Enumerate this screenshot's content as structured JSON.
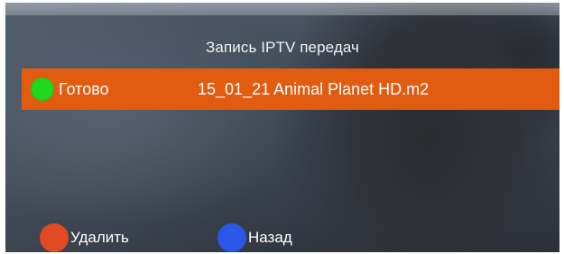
{
  "header": {
    "title": "Запись IPTV передач"
  },
  "recordings": [
    {
      "status": "Готово",
      "status_color": "#22d81c",
      "file_name": "15_01_21 Animal Planet HD.m2"
    }
  ],
  "footer": {
    "delete_label": "Удалить",
    "delete_color": "#e24a24",
    "back_label": "Назад",
    "back_color": "#2a57e8"
  },
  "colors": {
    "selected_row": "#e15b11"
  }
}
